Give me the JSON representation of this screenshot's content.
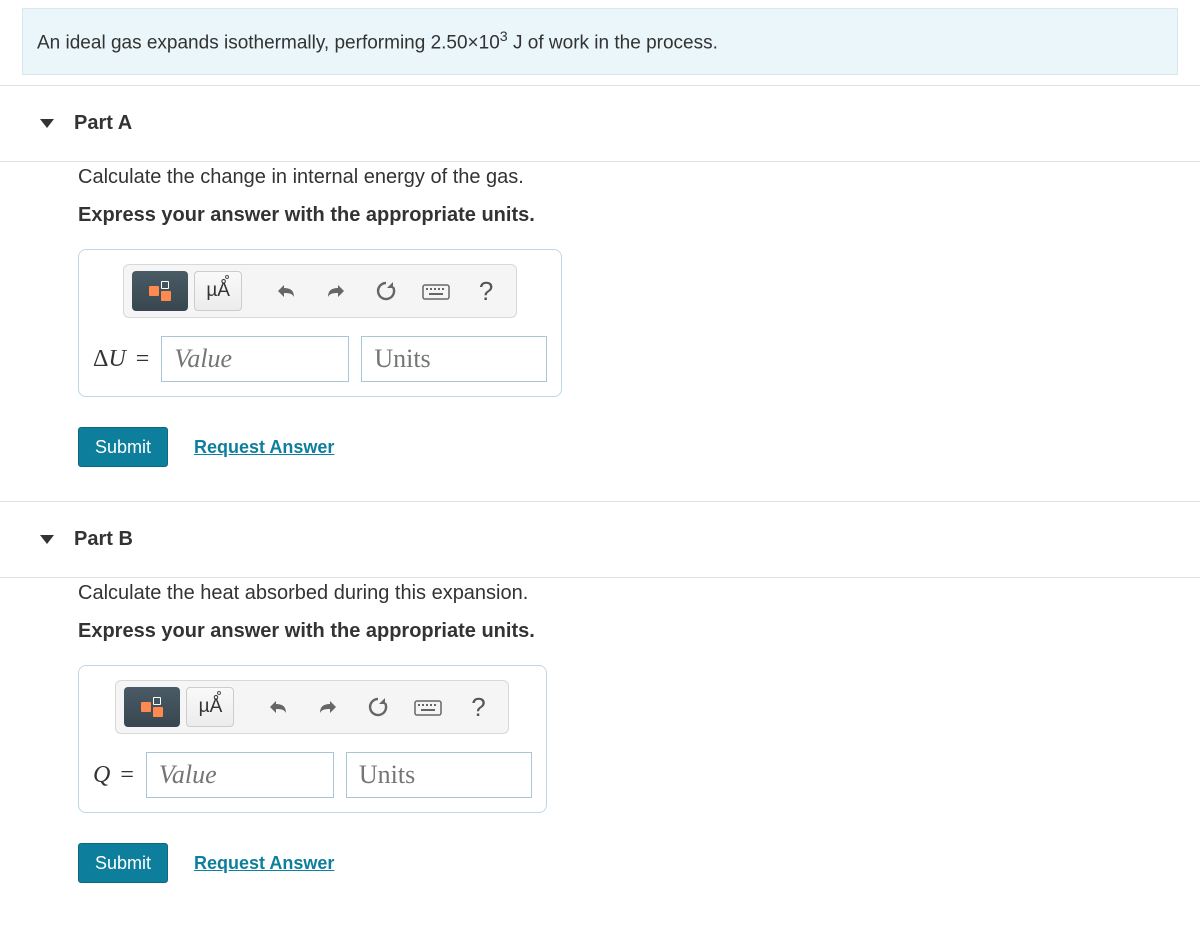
{
  "problem": {
    "text_before": "An ideal gas expands isothermally, performing ",
    "value": "2.50×10",
    "exp": "3",
    "text_after": " J of work in the process."
  },
  "toolbar": {
    "ma_label": "µÅ",
    "help_label": "?"
  },
  "parts": [
    {
      "title": "Part A",
      "prompt": "Calculate the change in internal energy of the gas.",
      "instruction": "Express your answer with the appropriate units.",
      "variable_html": "Δ<span style='font-style:italic'>U</span>",
      "value_placeholder": "Value",
      "units_placeholder": "Units",
      "submit_label": "Submit",
      "request_label": "Request Answer"
    },
    {
      "title": "Part B",
      "prompt": "Calculate the heat absorbed during this expansion.",
      "instruction": "Express your answer with the appropriate units.",
      "variable_html": "<span style='font-style:italic'>Q</span>",
      "value_placeholder": "Value",
      "units_placeholder": "Units",
      "submit_label": "Submit",
      "request_label": "Request Answer"
    }
  ]
}
